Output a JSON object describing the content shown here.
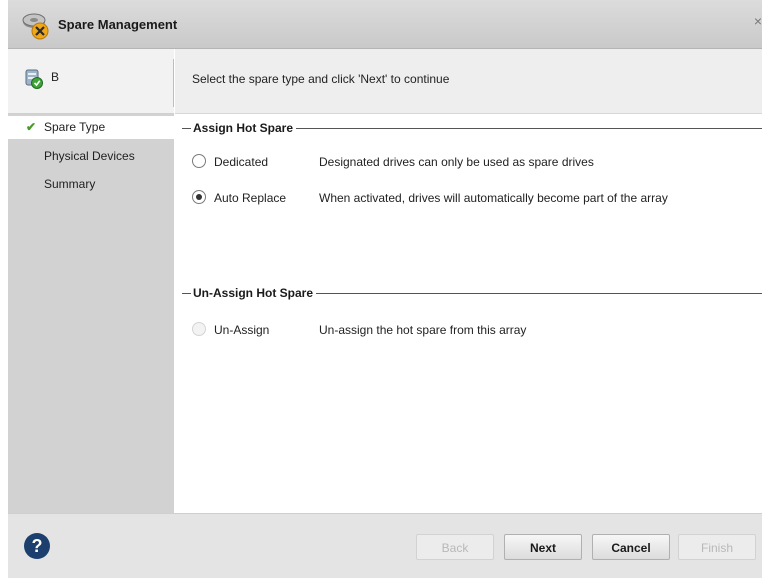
{
  "window": {
    "title": "Spare Management",
    "close_label": "×"
  },
  "sidebar": {
    "array_name": "B",
    "items": [
      {
        "label": "Spare Type",
        "active": true,
        "checked": true
      },
      {
        "label": "Physical Devices",
        "active": false,
        "checked": false
      },
      {
        "label": "Summary",
        "active": false,
        "checked": false
      }
    ]
  },
  "main": {
    "instruction": "Select the spare type and click 'Next' to continue",
    "assign_group": {
      "title": "Assign Hot Spare",
      "options": [
        {
          "label": "Dedicated",
          "description": "Designated drives can only be used as spare drives",
          "checked": false,
          "enabled": true
        },
        {
          "label": "Auto Replace",
          "description": "When activated, drives will automatically become part of the array",
          "checked": true,
          "enabled": true
        }
      ]
    },
    "unassign_group": {
      "title": "Un-Assign Hot Spare",
      "options": [
        {
          "label": "Un-Assign",
          "description": "Un-assign the hot spare from this array",
          "checked": false,
          "enabled": false
        }
      ]
    }
  },
  "footer": {
    "help_glyph": "?",
    "buttons": {
      "back": {
        "label": "Back",
        "enabled": false
      },
      "next": {
        "label": "Next",
        "enabled": true
      },
      "cancel": {
        "label": "Cancel",
        "enabled": true
      },
      "finish": {
        "label": "Finish",
        "enabled": false
      }
    }
  },
  "colors": {
    "check": "#4a9a2c",
    "help_icon": "#1c3f6e",
    "sidebar_bg": "#d2d2d2"
  }
}
